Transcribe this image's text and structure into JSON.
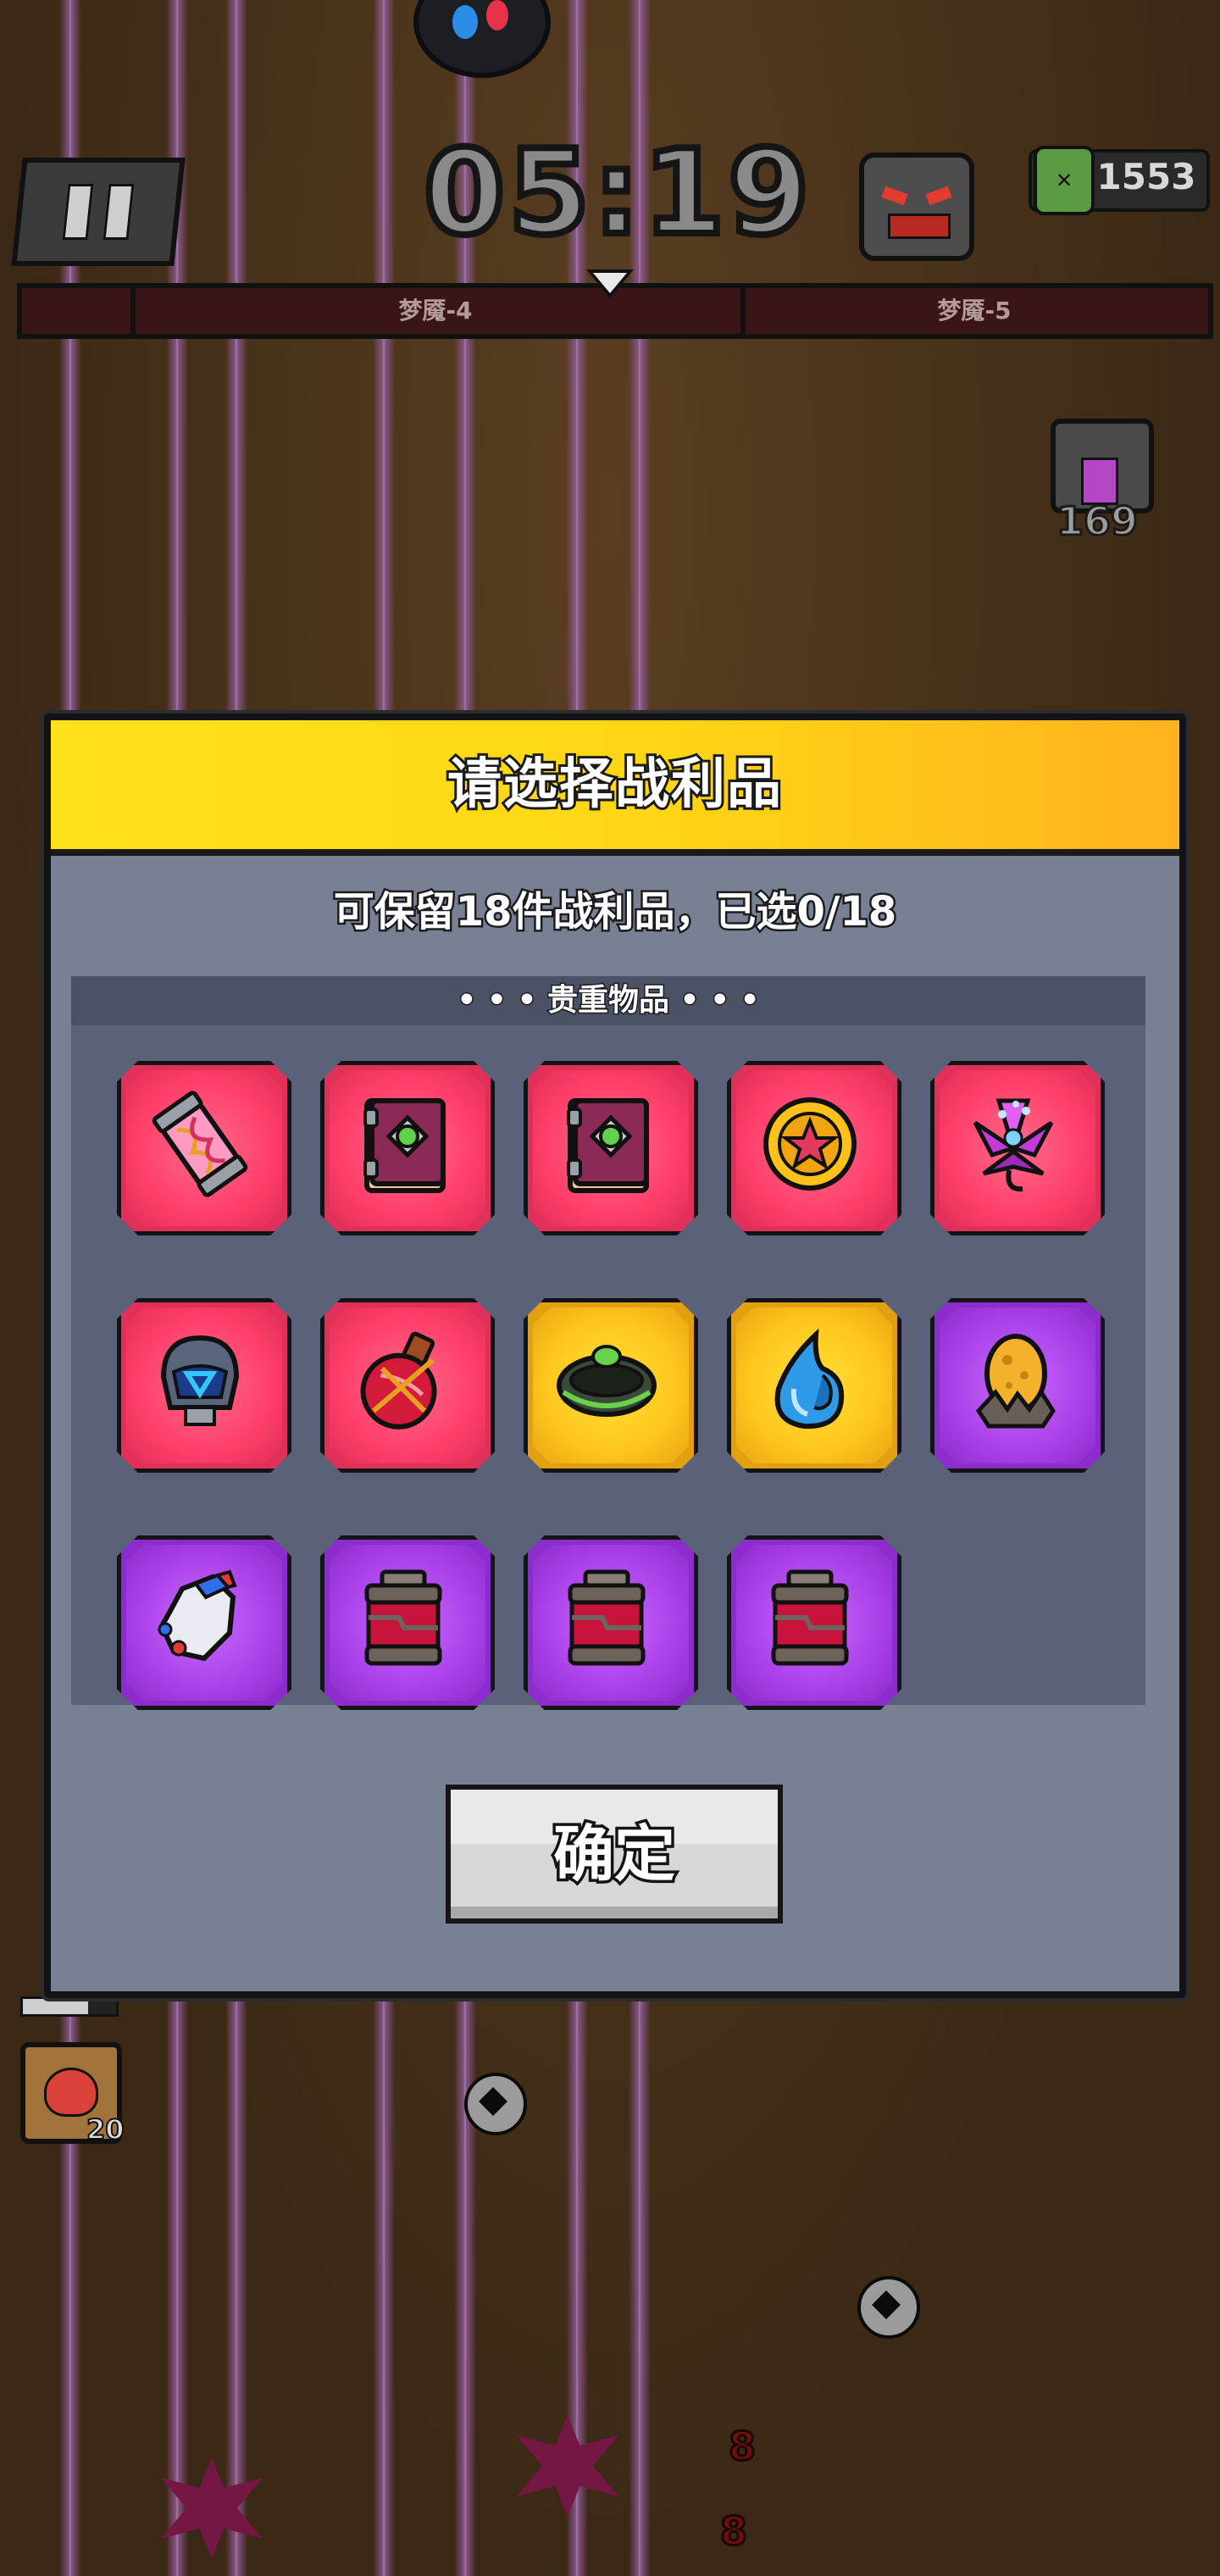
{
  "hud": {
    "timer": "05:19",
    "kill_count": "1553",
    "stage_current": "梦魇-4",
    "stage_next": "梦魇-5",
    "chest_count": "169",
    "heart_skill_count": "20"
  },
  "dialog": {
    "title": "请选择战利品",
    "subtitle": "可保留18件战利品，已选0/18",
    "section_title": "• • • 贵重物品 • • •",
    "confirm_label": "确定",
    "items": [
      {
        "icon": "dna-capsule-icon",
        "rarity": "red"
      },
      {
        "icon": "spellbook-icon",
        "rarity": "red"
      },
      {
        "icon": "spellbook-icon",
        "rarity": "red"
      },
      {
        "icon": "star-medal-icon",
        "rarity": "red"
      },
      {
        "icon": "purple-flower-icon",
        "rarity": "red"
      },
      {
        "icon": "cyber-helmet-icon",
        "rarity": "red"
      },
      {
        "icon": "potion-flask-icon",
        "rarity": "red"
      },
      {
        "icon": "green-gem-ring-icon",
        "rarity": "gold"
      },
      {
        "icon": "blue-water-drop-icon",
        "rarity": "gold"
      },
      {
        "icon": "golden-egg-icon",
        "rarity": "purple"
      },
      {
        "icon": "glove-icon",
        "rarity": "purple"
      },
      {
        "icon": "supply-jar-icon",
        "rarity": "purple"
      },
      {
        "icon": "supply-jar-icon",
        "rarity": "purple"
      },
      {
        "icon": "supply-jar-icon",
        "rarity": "purple"
      }
    ]
  },
  "colors": {
    "header_yellow": "#ffd515",
    "dialog_bg": "#788093",
    "panel_bg": "#5a6178",
    "rarity_red": "#ff3f6a",
    "rarity_gold": "#ffc61c",
    "rarity_purple": "#a941e8"
  }
}
